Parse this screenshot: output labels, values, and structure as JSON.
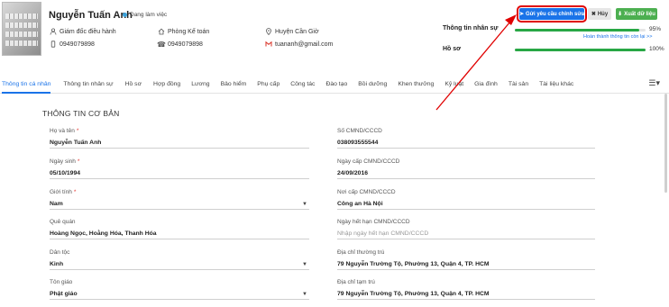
{
  "employee": {
    "name": "Nguyễn Tuấn Anh",
    "status": "Đang làm việc",
    "position": "Giám đốc điều hành",
    "department": "Phòng Kế toán",
    "location": "Huyện Cần Giờ",
    "mobile": "0949079898",
    "phone": "0949079898",
    "email": "tuananh@gmail.com"
  },
  "actions": {
    "request_edit": "Gửi yêu cầu chỉnh sửa",
    "cancel": "Hủy",
    "export": "Xuất dữ liệu"
  },
  "progress": {
    "staff_info_label": "Thông tin nhân sự",
    "staff_info_value": "95%",
    "staff_info_fraction": 0.95,
    "complete_link": "Hoàn thành thông tin còn lại >>",
    "profile_label": "Hồ sơ",
    "profile_value": "100%",
    "profile_fraction": 1.0
  },
  "tabs": [
    "Thông tin cá nhân",
    "Thông tin nhân sự",
    "Hồ sơ",
    "Hợp đồng",
    "Lương",
    "Bảo hiểm",
    "Phụ cấp",
    "Công tác",
    "Đào tạo",
    "Bồi dưỡng",
    "Khen thưởng",
    "Kỷ luật",
    "Gia đình",
    "Tài sản",
    "Tài liệu khác"
  ],
  "section_title": "THÔNG TIN CƠ BẢN",
  "form": {
    "full_name": {
      "label": "Họ và tên",
      "value": "Nguyễn Tuấn Anh"
    },
    "dob": {
      "label": "Ngày sinh",
      "value": "05/10/1994"
    },
    "gender": {
      "label": "Giới tính",
      "value": "Nam"
    },
    "hometown": {
      "label": "Quê quán",
      "value": "Hoàng Ngọc, Hoằng Hóa, Thanh Hóa"
    },
    "ethnicity": {
      "label": "Dân tộc",
      "value": "Kinh"
    },
    "religion": {
      "label": "Tôn giáo",
      "value": "Phật giáo"
    },
    "id_number": {
      "label": "Số CMND/CCCD",
      "value": "038093555544"
    },
    "id_issue_date": {
      "label": "Ngày cấp CMND/CCCD",
      "value": "24/09/2016"
    },
    "id_issue_place": {
      "label": "Nơi cấp CMND/CCCD",
      "value": "Công an Hà Nội"
    },
    "id_expiry": {
      "label": "Ngày hết hạn CMND/CCCD",
      "placeholder": "Nhập ngày hết hạn CMND/CCCD"
    },
    "permanent_address": {
      "label": "Địa chỉ thường trú",
      "value": "79 Nguyễn Trường Tộ, Phường 13, Quận 4, TP. HCM"
    },
    "temporary_address": {
      "label": "Địa chỉ tạm trú",
      "value": "79 Nguyễn Trường Tộ, Phường 13, Quận 4, TP. HCM"
    }
  },
  "colors": {
    "accent": "#1a73e8",
    "success": "#28a745",
    "highlight": "#e00000"
  }
}
